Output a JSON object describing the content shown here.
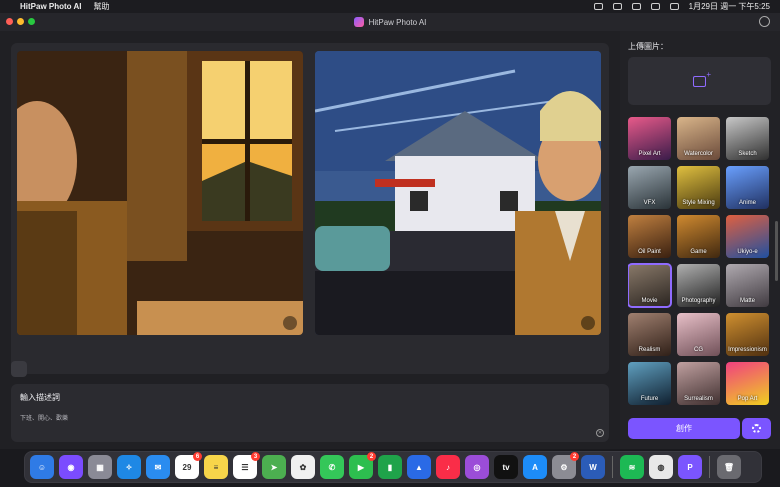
{
  "menubar": {
    "app_name": "HitPaw Photo AI",
    "menu_help": "幫助",
    "clock": "1月29日 週一 下午5:25"
  },
  "window": {
    "title": "HitPaw Photo AI"
  },
  "prompt": {
    "title": "輸入描述詞",
    "value": "下班、開心、歡樂"
  },
  "sidebar": {
    "upload_label": "上傳圖片：",
    "styles": [
      {
        "label": "Pixel Art",
        "colors": [
          "#e85a8a",
          "#3a1c4a"
        ]
      },
      {
        "label": "Watercolor",
        "colors": [
          "#d9b58a",
          "#6a4a3a"
        ]
      },
      {
        "label": "Sketch",
        "colors": [
          "#c8c8c8",
          "#303030"
        ]
      },
      {
        "label": "VFX",
        "colors": [
          "#9aa7b0",
          "#2a3338"
        ]
      },
      {
        "label": "Style Mixing",
        "colors": [
          "#e0c040",
          "#4a3a10"
        ]
      },
      {
        "label": "Anime",
        "colors": [
          "#6aa0ff",
          "#203060"
        ]
      },
      {
        "label": "Oil Paint",
        "colors": [
          "#c08040",
          "#3a2010"
        ]
      },
      {
        "label": "Game",
        "colors": [
          "#d08a30",
          "#402810"
        ]
      },
      {
        "label": "Ukiyo-e",
        "colors": [
          "#e06040",
          "#2050a0"
        ]
      },
      {
        "label": "Movie",
        "colors": [
          "#8a7a6a",
          "#2a2420"
        ]
      },
      {
        "label": "Photography",
        "colors": [
          "#b0b0b0",
          "#202020"
        ]
      },
      {
        "label": "Matte",
        "colors": [
          "#b0aab0",
          "#403a40"
        ]
      },
      {
        "label": "Realism",
        "colors": [
          "#a08070",
          "#302018"
        ]
      },
      {
        "label": "CG",
        "colors": [
          "#e8c0c8",
          "#705058"
        ]
      },
      {
        "label": "Impressionism",
        "colors": [
          "#d09030",
          "#503010"
        ]
      },
      {
        "label": "Future",
        "colors": [
          "#60a0c0",
          "#102030"
        ]
      },
      {
        "label": "Surrealism",
        "colors": [
          "#c0a0a0",
          "#403030"
        ]
      },
      {
        "label": "Pop Art",
        "colors": [
          "#f04080",
          "#f0d020"
        ]
      }
    ],
    "selected_style": "Movie",
    "create_label": "創作"
  },
  "dock": {
    "apps": [
      {
        "name": "finder",
        "color": "#2f7be6",
        "glyph": "☺"
      },
      {
        "name": "siri",
        "color": "#7b4cff",
        "glyph": "◉"
      },
      {
        "name": "launchpad",
        "color": "#8a8a96",
        "glyph": "▦"
      },
      {
        "name": "safari",
        "color": "#1e88e5",
        "glyph": "✧"
      },
      {
        "name": "mail",
        "color": "#2a8cf0",
        "glyph": "✉"
      },
      {
        "name": "calendar",
        "color": "#ffffff",
        "glyph": "29",
        "badge": "6"
      },
      {
        "name": "notes",
        "color": "#f7d54a",
        "glyph": "≡"
      },
      {
        "name": "reminders",
        "color": "#ffffff",
        "glyph": "☰",
        "badge": "3"
      },
      {
        "name": "maps",
        "color": "#4caf50",
        "glyph": "➤"
      },
      {
        "name": "photos",
        "color": "#f0f0f0",
        "glyph": "✿"
      },
      {
        "name": "messages",
        "color": "#34c759",
        "glyph": "✆"
      },
      {
        "name": "facetime",
        "color": "#2dbe4f",
        "glyph": "▶",
        "badge": "2"
      },
      {
        "name": "numbers",
        "color": "#1fa34a",
        "glyph": "▮"
      },
      {
        "name": "keynote",
        "color": "#2a6ae6",
        "glyph": "▲"
      },
      {
        "name": "music",
        "color": "#fa2d48",
        "glyph": "♪"
      },
      {
        "name": "podcasts",
        "color": "#9b4dd8",
        "glyph": "◎"
      },
      {
        "name": "apple-tv",
        "color": "#111111",
        "glyph": "tv"
      },
      {
        "name": "app-store",
        "color": "#1d8cf8",
        "glyph": "A"
      },
      {
        "name": "system-settings",
        "color": "#8c8c94",
        "glyph": "⚙",
        "badge": "2"
      },
      {
        "name": "word",
        "color": "#2b5cb8",
        "glyph": "W"
      },
      {
        "name": "spotify",
        "color": "#1db954",
        "glyph": "≋"
      },
      {
        "name": "chrome",
        "color": "#e8e8e8",
        "glyph": "◍"
      },
      {
        "name": "hitpaw",
        "color": "#7b55ff",
        "glyph": "P"
      },
      {
        "name": "trash",
        "color": "#6a6a70",
        "glyph": "🗑"
      }
    ]
  }
}
